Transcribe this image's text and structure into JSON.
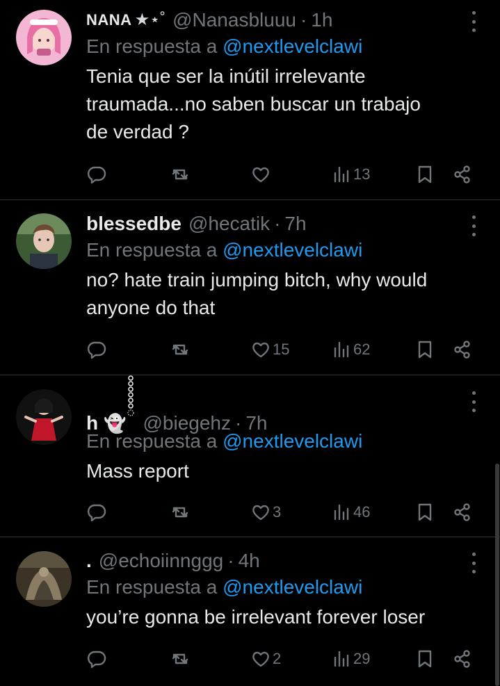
{
  "tweets": [
    {
      "name": "NANA",
      "badges": "★⋆˚",
      "handle": "@Nanasbluuu",
      "time": "1h",
      "reply_prefix": "En respuesta a",
      "reply_to": "@nextlevelclawi",
      "text_lines": [
        "Tenia que ser la inútil irrelevante",
        "traumada...no saben buscar un trabajo",
        "de verdad ?"
      ],
      "likes": "",
      "views": "13"
    },
    {
      "name": "blessedbe",
      "handle": "@hecatik",
      "time": "7h",
      "reply_prefix": "En respuesta a",
      "reply_to": "@nextlevelclawi",
      "text_lines": [
        "no? hate train jumping bitch, why would",
        "anyone do that"
      ],
      "likes": "15",
      "views": "62"
    },
    {
      "name": "h",
      "emoji": "👻",
      "handle": "@biegehz",
      "time": "7h",
      "reply_prefix": "En respuesta a",
      "reply_to": "@nextlevelclawi",
      "text_lines": [
        "Mass report"
      ],
      "likes": "3",
      "views": "46"
    },
    {
      "name": ".",
      "handle": "@echoiinnggg",
      "time": "4h",
      "reply_prefix": "En respuesta a",
      "reply_to": "@nextlevelclawi",
      "text_lines": [
        "you’re gonna be irrelevant forever loser"
      ],
      "likes": "2",
      "views": "29"
    }
  ],
  "separator": "·",
  "colors": {
    "background": "#000000",
    "primary_text": "#e7e9ea",
    "secondary_text": "#71767b",
    "link": "#1d9bf0",
    "divider": "#2f3336"
  },
  "icons": {
    "reply": "reply-icon",
    "retweet": "retweet-icon",
    "like": "heart-icon",
    "views": "views-icon",
    "bookmark": "bookmark-icon",
    "share": "share-icon",
    "more": "more-options-icon"
  }
}
